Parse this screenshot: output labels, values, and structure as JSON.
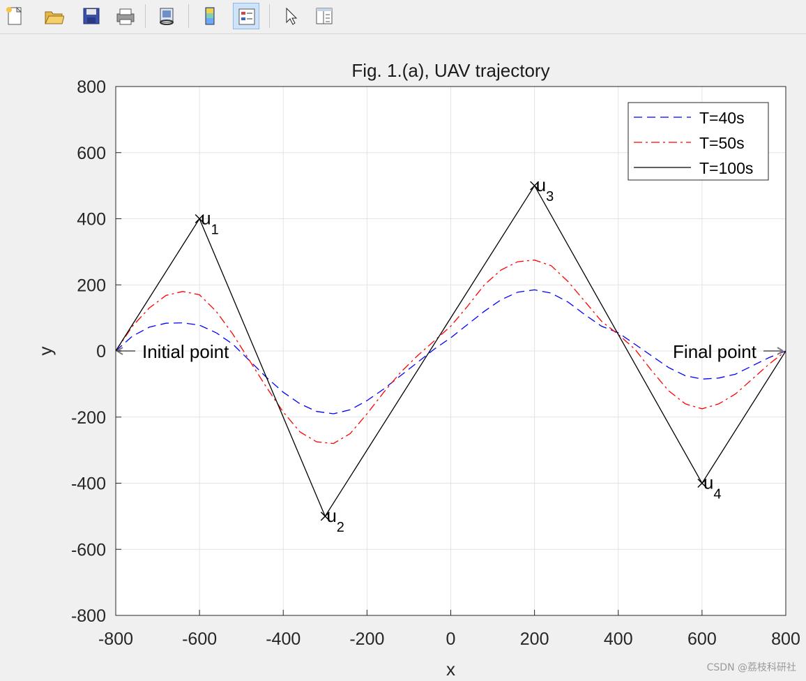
{
  "toolbar": {
    "buttons": [
      {
        "name": "new-figure-icon"
      },
      {
        "name": "open-file-icon"
      },
      {
        "name": "save-icon"
      },
      {
        "name": "print-icon"
      },
      {
        "name": "link-plot-icon"
      },
      {
        "name": "colorbar-icon"
      },
      {
        "name": "legend-icon",
        "active": true
      },
      {
        "name": "pointer-icon"
      },
      {
        "name": "property-inspector-icon"
      }
    ]
  },
  "chart_data": {
    "type": "line",
    "title": "Fig. 1.(a), UAV trajectory",
    "xlabel": "x",
    "ylabel": "y",
    "xlim": [
      -800,
      800
    ],
    "ylim": [
      -800,
      800
    ],
    "xticks": [
      "-800",
      "-600",
      "-400",
      "-200",
      "0",
      "200",
      "400",
      "600",
      "800"
    ],
    "yticks": [
      "800",
      "600",
      "400",
      "200",
      "0",
      "-200",
      "-400",
      "-600",
      "-800"
    ],
    "grid": true,
    "legend_position": "top-right",
    "series": [
      {
        "name": "T=40s",
        "color": "#0000ff",
        "style": "dashed",
        "x": [
          -800,
          -760,
          -720,
          -680,
          -640,
          -600,
          -560,
          -520,
          -480,
          -440,
          -400,
          -360,
          -320,
          -280,
          -240,
          -200,
          -160,
          -120,
          -80,
          -40,
          0,
          40,
          80,
          120,
          160,
          200,
          240,
          280,
          320,
          360,
          400,
          440,
          480,
          520,
          560,
          600,
          640,
          680,
          720,
          760,
          800
        ],
        "y": [
          0,
          45,
          72,
          84,
          85,
          78,
          55,
          20,
          -30,
          -80,
          -125,
          -160,
          -183,
          -190,
          -178,
          -150,
          -115,
          -75,
          -35,
          5,
          40,
          80,
          120,
          155,
          178,
          185,
          175,
          148,
          110,
          75,
          55,
          20,
          -15,
          -50,
          -75,
          -85,
          -82,
          -70,
          -45,
          -20,
          0
        ]
      },
      {
        "name": "T=50s",
        "color": "#ff0000",
        "style": "dashdot",
        "x": [
          -800,
          -760,
          -720,
          -680,
          -640,
          -600,
          -560,
          -520,
          -480,
          -440,
          -400,
          -360,
          -320,
          -280,
          -240,
          -200,
          -160,
          -120,
          -80,
          -40,
          0,
          40,
          80,
          120,
          160,
          200,
          240,
          280,
          320,
          360,
          400,
          440,
          480,
          520,
          560,
          600,
          640,
          680,
          720,
          760,
          800
        ],
        "y": [
          0,
          75,
          130,
          168,
          180,
          170,
          120,
          50,
          -30,
          -110,
          -185,
          -245,
          -275,
          -280,
          -250,
          -190,
          -125,
          -65,
          -15,
          30,
          75,
          135,
          200,
          245,
          270,
          275,
          258,
          210,
          150,
          90,
          50,
          5,
          -60,
          -120,
          -160,
          -175,
          -160,
          -130,
          -85,
          -40,
          0
        ]
      },
      {
        "name": "T=100s",
        "color": "#000000",
        "style": "solid",
        "x": [
          -800,
          -600,
          -300,
          200,
          600,
          800
        ],
        "y": [
          0,
          400,
          -500,
          500,
          -400,
          0
        ]
      }
    ],
    "annotations": {
      "waypoints": [
        {
          "main": "u",
          "sub": "1",
          "x": -600,
          "y": 400
        },
        {
          "main": "u",
          "sub": "2",
          "x": -300,
          "y": -500
        },
        {
          "main": "u",
          "sub": "3",
          "x": 200,
          "y": 500
        },
        {
          "main": "u",
          "sub": "4",
          "x": 600,
          "y": -400
        }
      ],
      "initial_label": "Initial point",
      "final_label": "Final point"
    }
  },
  "watermark": "CSDN @荔枝科研社"
}
